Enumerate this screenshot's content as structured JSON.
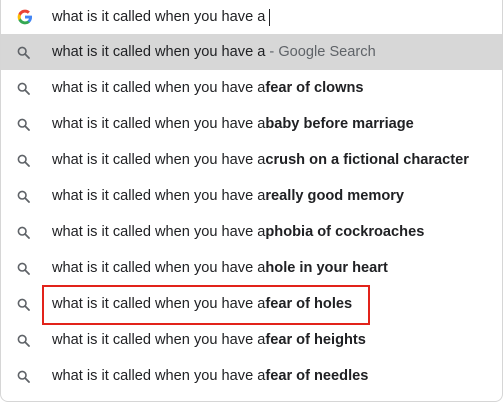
{
  "input": {
    "value": "what is it called when you have a"
  },
  "highlighted_row": {
    "prefix": "what is it called when you have a",
    "suffix": " - Google Search"
  },
  "suggestions": [
    {
      "prefix": "what is it called when you have a",
      "completion": "fear of clowns"
    },
    {
      "prefix": "what is it called when you have a",
      "completion": "baby before marriage"
    },
    {
      "prefix": "what is it called when you have a",
      "completion": "crush on a fictional character"
    },
    {
      "prefix": "what is it called when you have a",
      "completion": "really good memory"
    },
    {
      "prefix": "what is it called when you have a",
      "completion": "phobia of cockroaches"
    },
    {
      "prefix": "what is it called when you have a",
      "completion": "hole in your heart"
    },
    {
      "prefix": "what is it called when you have a",
      "completion": "fear of holes"
    },
    {
      "prefix": "what is it called when you have a",
      "completion": "fear of heights"
    },
    {
      "prefix": "what is it called when you have a",
      "completion": "fear of needles"
    }
  ],
  "icons": {
    "logo": "google-g-icon",
    "search": "search-icon"
  },
  "colors": {
    "highlight": "#d7d7d7",
    "annotation": "#e2231a",
    "muted": "#5f6368"
  }
}
